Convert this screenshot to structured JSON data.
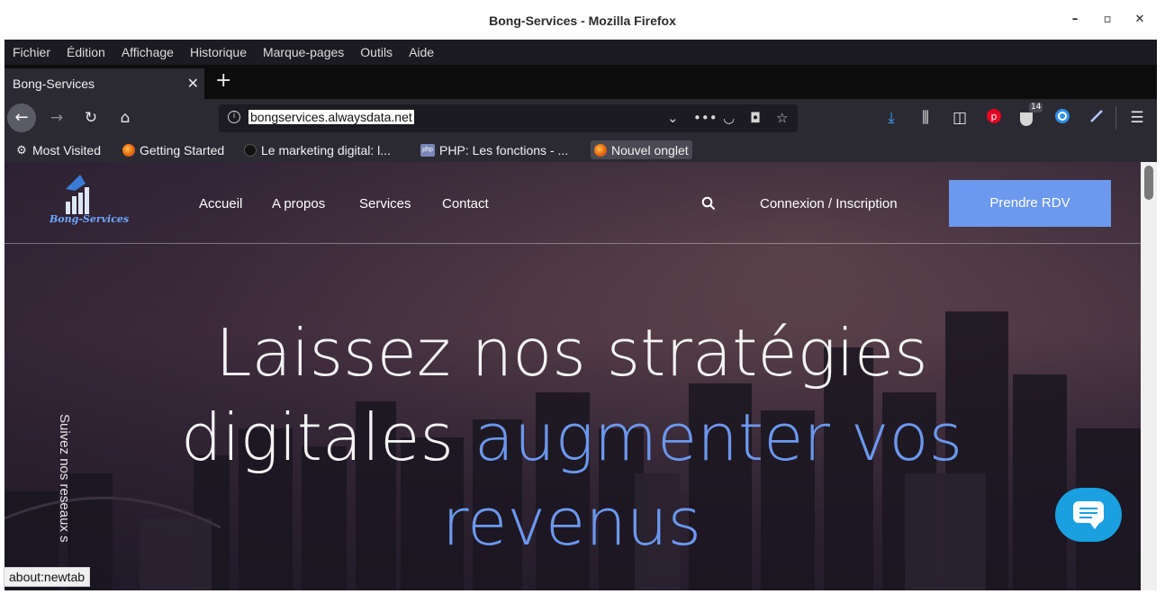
{
  "window": {
    "title": "Bong-Services - Mozilla Firefox",
    "minimize": "–",
    "maximize": "▫",
    "close": "✕"
  },
  "menubar": [
    "Fichier",
    "Édition",
    "Affichage",
    "Historique",
    "Marque-pages",
    "Outils",
    "Aide"
  ],
  "tabs": [
    {
      "label": "Bong-Services"
    }
  ],
  "navbar": {
    "url": "bongservices.alwaysdata.net",
    "pocket_badge": "14"
  },
  "bookmarks": [
    "Most Visited",
    "Getting Started",
    "Le marketing digital: l...",
    "PHP: Les fonctions - ...",
    "Nouvel onglet"
  ],
  "site": {
    "logo_text": "Bong-Services",
    "nav": [
      "Accueil",
      "A propos",
      "Services",
      "Contact"
    ],
    "login": "Connexion / Inscription",
    "cta": "Prendre RDV",
    "hero_line1": "Laissez nos stratégies",
    "hero_line2_plain": "digitales",
    "hero_line2_accent": "augmenter vos",
    "hero_line3_accent": "revenus",
    "social_vertical": "Suivez nos reseaux s"
  },
  "status": "about:newtab",
  "colors": {
    "accent": "#6c98ee",
    "chat": "#1aa0e0"
  }
}
